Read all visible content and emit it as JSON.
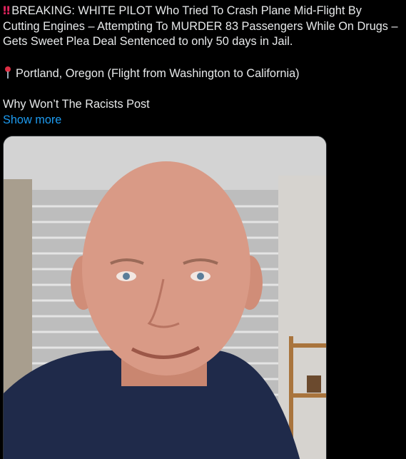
{
  "tweet": {
    "lines": [
      {
        "icon": "double-exclamation-icon",
        "glyph": "‼",
        "text": "BREAKING: WHITE PILOT Who Tried To Crash Plane Mid-Flight By"
      },
      {
        "icon": "",
        "glyph": "",
        "text": "Cutting Engines – Attempting To MURDER 83 Passengers While On Drugs –"
      },
      {
        "icon": "",
        "glyph": "",
        "text": "Gets Sweet Plea Deal Sentenced to only 50 days in Jail."
      }
    ],
    "location": {
      "icon": "round-pushpin-icon",
      "text": "Portland, Oregon (Flight from Washington to California)"
    },
    "teaser": "Why Won’t The Racists Post",
    "show_more": "Show more"
  },
  "media": {
    "description_icon": "selfie-photo",
    "colors": {
      "ceiling": "#cfcfcf",
      "brick": "#bdbdbd",
      "mortar": "#e6e6e6",
      "skin": "#d99a86",
      "hoodie": "#1f2a4a",
      "shelf": "#a9743d"
    }
  }
}
